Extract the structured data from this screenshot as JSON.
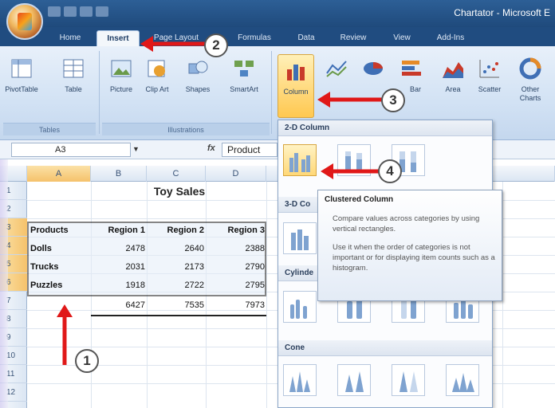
{
  "window": {
    "title": "Chartator - Microsoft E",
    "quick_access_count": 4
  },
  "tabs": [
    {
      "label": "Home"
    },
    {
      "label": "Insert"
    },
    {
      "label": "Page Layout"
    },
    {
      "label": "Formulas"
    },
    {
      "label": "Data"
    },
    {
      "label": "Review"
    },
    {
      "label": "View"
    },
    {
      "label": "Add-Ins"
    }
  ],
  "ribbon": {
    "buttons": [
      {
        "label": "PivotTable",
        "icon": "pivot-table-icon"
      },
      {
        "label": "Table",
        "icon": "table-icon"
      },
      {
        "label": "Picture",
        "icon": "picture-icon"
      },
      {
        "label": "Clip Art",
        "icon": "clip-art-icon"
      },
      {
        "label": "Shapes",
        "icon": "shapes-icon"
      },
      {
        "label": "SmartArt",
        "icon": "smartart-icon"
      },
      {
        "label": "Column",
        "icon": "column-chart-icon"
      },
      {
        "label": "Line",
        "icon": "line-chart-icon"
      },
      {
        "label": "Pie",
        "icon": "pie-chart-icon"
      },
      {
        "label": "Bar",
        "icon": "bar-chart-icon"
      },
      {
        "label": "Area",
        "icon": "area-chart-icon"
      },
      {
        "label": "Scatter",
        "icon": "scatter-chart-icon"
      },
      {
        "label": "Other Charts",
        "icon": "other-charts-icon"
      }
    ],
    "groups": [
      {
        "label": "Tables"
      },
      {
        "label": "Illustrations"
      }
    ]
  },
  "formula_bar": {
    "name_box": "A3",
    "fx": "fx",
    "content": "Product"
  },
  "sheet": {
    "columns": [
      "A",
      "B",
      "C",
      "D"
    ],
    "rows": [
      "1",
      "2",
      "3",
      "4",
      "5",
      "6",
      "7",
      "8",
      "9",
      "10",
      "11",
      "12"
    ],
    "title": "Toy Sales",
    "headers": [
      "Products",
      "Region 1",
      "Region 2",
      "Region 3"
    ],
    "data": [
      {
        "product": "Dolls",
        "values": [
          "2478",
          "2640",
          "2388"
        ]
      },
      {
        "product": "Trucks",
        "values": [
          "2031",
          "2173",
          "2790"
        ]
      },
      {
        "product": "Puzzles",
        "values": [
          "1918",
          "2722",
          "2795"
        ]
      }
    ],
    "totals": [
      "6427",
      "7535",
      "7973"
    ]
  },
  "gallery": {
    "sections": [
      {
        "label": "2-D Column"
      },
      {
        "label": "3-D Co"
      },
      {
        "label": "Cylinde"
      },
      {
        "label": "Cone"
      }
    ]
  },
  "tooltip": {
    "title": "Clustered Column",
    "paragraph1": "Compare values across categories by using vertical rectangles.",
    "paragraph2": "Use it when the order of categories is not important or for displaying item counts such as a histogram."
  },
  "annotations": {
    "step1": "1",
    "step2": "2",
    "step3": "3",
    "step4": "4"
  },
  "colors": {
    "title_bar": "#2d5f96",
    "ribbon": "#d2e2f4",
    "highlight": "#ffc850",
    "arrow_red": "#e01818"
  }
}
